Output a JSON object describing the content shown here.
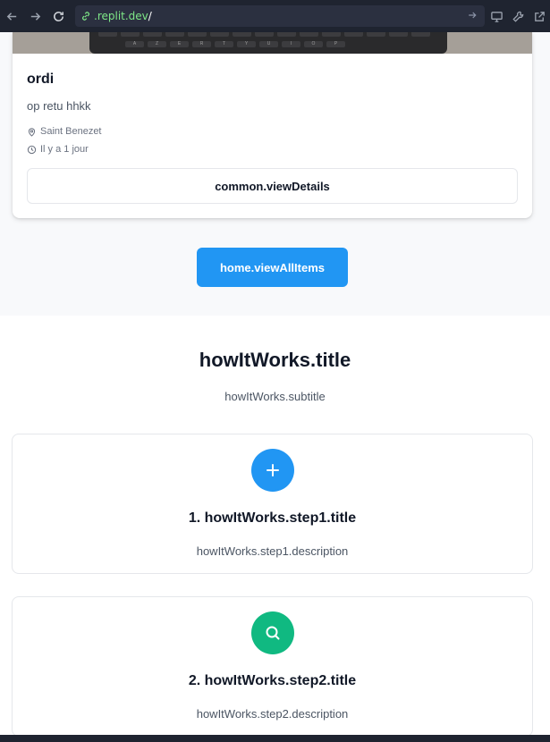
{
  "browser": {
    "address_host": ".replit.dev",
    "address_path": "/"
  },
  "listing": {
    "keyboard_keys": [
      "A",
      "Z",
      "E",
      "R",
      "T",
      "Y",
      "U",
      "I",
      "O",
      "P"
    ],
    "card": {
      "title": "ordi",
      "description": "op retu hhkk",
      "location": "Saint Benezet",
      "posted": "Il y a 1 jour",
      "details_label": "common.viewDetails"
    },
    "view_all_label": "home.viewAllItems"
  },
  "how_it_works": {
    "title": "howItWorks.title",
    "subtitle": "howItWorks.subtitle",
    "steps": [
      {
        "title": "1. howItWorks.step1.title",
        "description": "howItWorks.step1.description",
        "icon": "plus-icon",
        "color": "#2196f3"
      },
      {
        "title": "2. howItWorks.step2.title",
        "description": "howItWorks.step2.description",
        "icon": "search-icon",
        "color": "#10b981"
      }
    ]
  },
  "colors": {
    "primary": "#2196f3",
    "success": "#10b981",
    "toolbar": "#1f2430",
    "url_host": "#7ee787"
  }
}
